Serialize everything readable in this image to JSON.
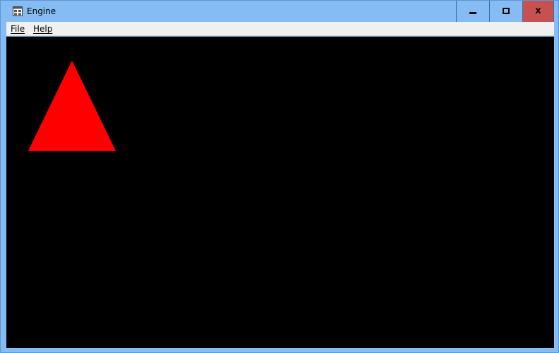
{
  "window": {
    "title": "Engine",
    "icon": "app-window-icon",
    "controls": {
      "minimize_icon": "minimize-icon",
      "maximize_icon": "maximize-icon",
      "close_icon": "close-icon",
      "close_glyph": "x"
    }
  },
  "menu": {
    "items": [
      {
        "label": "File"
      },
      {
        "label": "Help"
      }
    ]
  },
  "viewport": {
    "background_color": "#000000",
    "shape_name": "triangle",
    "shape_color": "#ff0000"
  },
  "colors": {
    "frame": "#85bcf4",
    "close_button": "#c75050",
    "menu_background": "#f0f0f0"
  }
}
